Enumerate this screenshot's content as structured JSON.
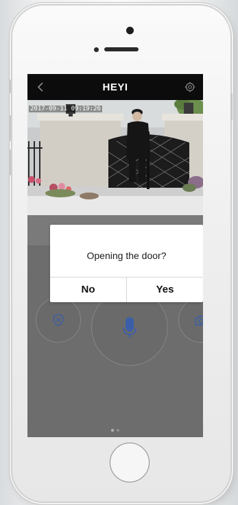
{
  "header": {
    "title": "HEYI",
    "back_icon": "chevron-left-icon",
    "settings_icon": "gear-icon"
  },
  "video": {
    "timestamp": "2017-09-11 09:19:26"
  },
  "controls": {
    "left_icon": "shield-icon",
    "center_icon": "microphone-icon",
    "right_icon": "camera-icon",
    "accent_color": "#3a5fa8"
  },
  "dialog": {
    "message": "Opening the door?",
    "no_label": "No",
    "yes_label": "Yes"
  },
  "pager": {
    "pages": 2,
    "active": 1
  }
}
